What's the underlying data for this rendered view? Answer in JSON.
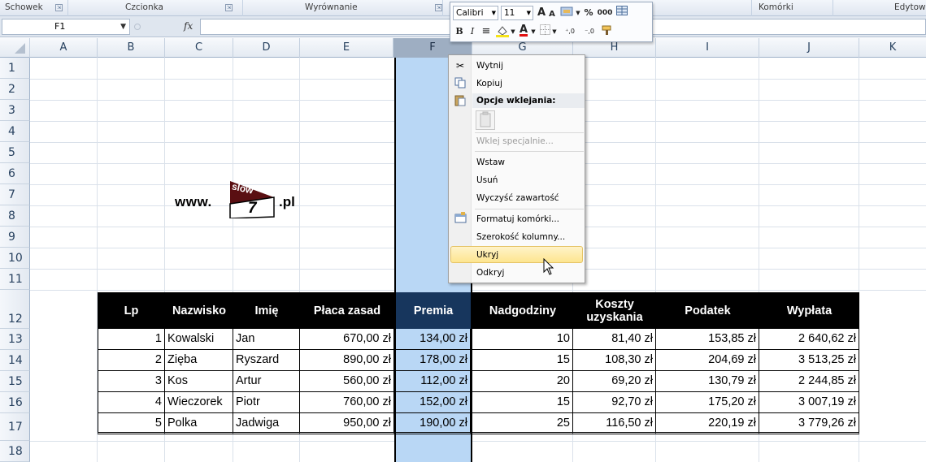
{
  "ribbon": {
    "groups": [
      {
        "label": "Schowek",
        "launcher": "⇲"
      },
      {
        "label": "Czcionka",
        "launcher": "⇲"
      },
      {
        "label": "Wyrównanie",
        "launcher": "⇲"
      },
      {
        "label": "Komórki"
      },
      {
        "label": "Edytow"
      }
    ]
  },
  "formula_bar": {
    "name_box": "F1",
    "fx_label": "fx",
    "value": ""
  },
  "columns": [
    "A",
    "B",
    "C",
    "D",
    "E",
    "F",
    "G",
    "H",
    "I",
    "J",
    "K"
  ],
  "selected_column": "F",
  "rows": [
    "1",
    "2",
    "3",
    "4",
    "5",
    "6",
    "7",
    "8",
    "9",
    "10",
    "11",
    "12",
    "13",
    "14",
    "15",
    "16",
    "17",
    "18"
  ],
  "logo": {
    "prefix": "www.",
    "middle_top": "slow",
    "middle_bottom": "7",
    "suffix": ".pl"
  },
  "table": {
    "headers": [
      "Lp",
      "Nazwisko",
      "Imię",
      "Płaca zasad",
      "Premia",
      "Nadgodziny",
      "Koszty uzyskania",
      "Podatek",
      "Wypłata"
    ],
    "rows": [
      [
        "1",
        "Kowalski",
        "Jan",
        "670,00 zł",
        "134,00 zł",
        "10",
        "81,40 zł",
        "153,85 zł",
        "2 640,62 zł"
      ],
      [
        "2",
        "Zięba",
        "Ryszard",
        "890,00 zł",
        "178,00 zł",
        "15",
        "108,30 zł",
        "204,69 zł",
        "3 513,25 zł"
      ],
      [
        "3",
        "Kos",
        "Artur",
        "560,00 zł",
        "112,00 zł",
        "20",
        "69,20 zł",
        "130,79 zł",
        "2 244,85 zł"
      ],
      [
        "4",
        "Wieczorek",
        "Piotr",
        "760,00 zł",
        "152,00 zł",
        "15",
        "92,70 zł",
        "175,20 zł",
        "3 007,19 zł"
      ],
      [
        "5",
        "Polka",
        "Jadwiga",
        "950,00 zł",
        "190,00 zł",
        "25",
        "116,50 zł",
        "220,19 zł",
        "3 779,26 zł"
      ]
    ]
  },
  "mini_toolbar": {
    "font": "Calibri",
    "size": "11",
    "grow": "A",
    "shrink": "A",
    "percent": "%",
    "thousands": "000",
    "bold": "B",
    "italic": "I",
    "font_color": "A",
    "inc_decimal": "⁺,0",
    "dec_decimal": "⁻,0"
  },
  "context_menu": {
    "items": [
      {
        "label": "Wytnij",
        "icon": "scissors-icon"
      },
      {
        "label": "Kopiuj",
        "icon": "copy-icon"
      },
      {
        "label": "Opcje wklejania:",
        "icon": "paste-icon"
      },
      {
        "label": "Wklej specjalnie...",
        "disabled": true
      },
      {
        "label": "Wstaw"
      },
      {
        "label": "Usuń"
      },
      {
        "label": "Wyczyść zawartość"
      },
      {
        "label": "Formatuj komórki...",
        "icon": "format-cells-icon"
      },
      {
        "label": "Szerokość kolumny..."
      },
      {
        "label": "Ukryj",
        "highlighted": true
      },
      {
        "label": "Odkryj"
      }
    ]
  },
  "colors": {
    "header_bg": "#000000",
    "premia_header_bg": "#17365d",
    "selection": "#b9d7f5",
    "menu_highlight": "#fde58f",
    "logo_dark": "#5a0f12"
  }
}
